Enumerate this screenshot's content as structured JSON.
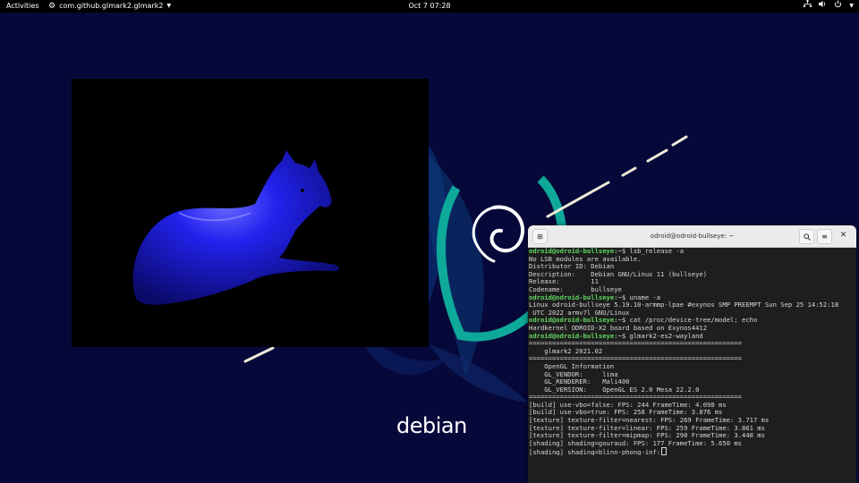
{
  "topbar": {
    "activities": "Activities",
    "app_name": "com.github.glmark2.glmark2",
    "clock": "Oct 7  07:28",
    "tray_icons": [
      "network-icon",
      "volume-icon",
      "power-icon"
    ]
  },
  "wallpaper": {
    "brand_text": "debian",
    "colors": {
      "background": "#07083a",
      "accent_teal": "#0ea99a",
      "swirl": "#ffffff"
    }
  },
  "terminal": {
    "title": "odroid@odroid-bullseye: ~",
    "prompt": "odroid@odroid-bullseye:",
    "lines": [
      {
        "type": "cmd",
        "prompt": "odroid@odroid-bullseye:",
        "text": "~$ lsb_release -a"
      },
      {
        "type": "out",
        "text": "No LSB modules are available."
      },
      {
        "type": "out",
        "text": "Distributor ID: Debian"
      },
      {
        "type": "out",
        "text": "Description:    Debian GNU/Linux 11 (bullseye)"
      },
      {
        "type": "out",
        "text": "Release:        11"
      },
      {
        "type": "out",
        "text": "Codename:       bullseye"
      },
      {
        "type": "cmd",
        "prompt": "odroid@odroid-bullseye:",
        "text": "~$ uname -a"
      },
      {
        "type": "out",
        "text": "Linux odroid-bullseye 5.19.10-armmp-lpae #exynos SMP PREEMPT Sun Sep 25 14:52:18"
      },
      {
        "type": "out",
        "text": " UTC 2022 armv7l GNU/Linux"
      },
      {
        "type": "cmd",
        "prompt": "odroid@odroid-bullseye:",
        "text": "~$ cat /proc/device-tree/model; echo"
      },
      {
        "type": "out",
        "text": "Hardkernel ODROID-X2 board based on Exynos4412"
      },
      {
        "type": "cmd",
        "prompt": "odroid@odroid-bullseye:",
        "text": "~$ glmark2-es2-wayland"
      },
      {
        "type": "out",
        "text": "======================================================="
      },
      {
        "type": "out",
        "text": "    glmark2 2021.02"
      },
      {
        "type": "out",
        "text": "======================================================="
      },
      {
        "type": "out",
        "text": "    OpenGL Information"
      },
      {
        "type": "out",
        "text": "    GL_VENDOR:     lima"
      },
      {
        "type": "out",
        "text": "    GL_RENDERER:   Mali400"
      },
      {
        "type": "out",
        "text": "    GL_VERSION:    OpenGL ES 2.0 Mesa 22.2.0"
      },
      {
        "type": "out",
        "text": "======================================================="
      },
      {
        "type": "out",
        "text": "[build] use-vbo=false: FPS: 244 FrameTime: 4.098 ms"
      },
      {
        "type": "out",
        "text": "[build] use-vbo=true: FPS: 258 FrameTime: 3.876 ms"
      },
      {
        "type": "out",
        "text": "[texture] texture-filter=nearest: FPS: 269 FrameTime: 3.717 ms"
      },
      {
        "type": "out",
        "text": "[texture] texture-filter=linear: FPS: 259 FrameTime: 3.861 ms"
      },
      {
        "type": "out",
        "text": "[texture] texture-filter=mipmap: FPS: 290 FrameTime: 3.448 ms"
      },
      {
        "type": "out",
        "text": "[shading] shading=gouraud: FPS: 177 FrameTime: 5.650 ms"
      },
      {
        "type": "last",
        "text": "[shading] shading=blinn-phong-inf:"
      }
    ]
  }
}
